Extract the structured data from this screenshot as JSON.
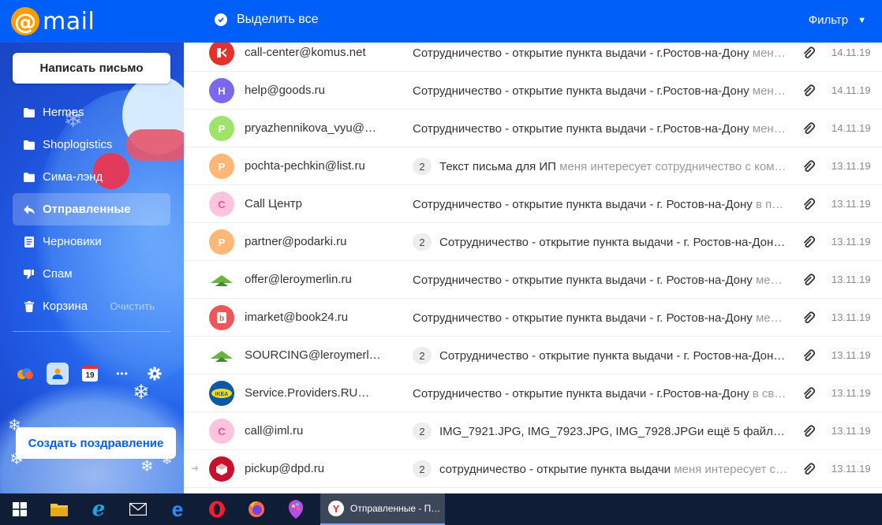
{
  "header": {
    "logo_symbol": "@",
    "logo_text": "mail",
    "select_all_label": "Выделить все",
    "filter_label": "Фильтр",
    "filter_caret": "▼",
    "accent_color": "#005ff9"
  },
  "sidebar": {
    "compose_label": "Написать письмо",
    "folders": [
      {
        "label": "Hermes",
        "icon": "folder-icon"
      },
      {
        "label": "Shoplogistics",
        "icon": "folder-icon"
      },
      {
        "label": "Сима-лэнд",
        "icon": "folder-icon"
      },
      {
        "label": "Отправленные",
        "icon": "sent-icon",
        "active": true
      },
      {
        "label": "Черновики",
        "icon": "drafts-icon"
      },
      {
        "label": "Спам",
        "icon": "spam-icon"
      },
      {
        "label": "Корзина",
        "icon": "trash-icon",
        "action": "Очистить"
      }
    ],
    "apps": [
      {
        "name": "cloud-icon"
      },
      {
        "name": "contacts-icon"
      },
      {
        "name": "calendar-icon",
        "text": "19"
      },
      {
        "name": "more-icon",
        "text": "•••"
      },
      {
        "name": "settings-icon"
      }
    ],
    "greeting_label": "Создать поздравление"
  },
  "messages": [
    {
      "sender": "call-center@komus.net",
      "count": "",
      "subject": "Сотрудничество - открытие пункта выдачи - г.Ростов-на-Дону",
      "snippet": " мен…",
      "date": "14.11.19",
      "avatar": {
        "type": "logo",
        "name": "komus-logo",
        "bg": "#e5312b"
      }
    },
    {
      "sender": "help@goods.ru",
      "count": "",
      "subject": "Сотрудничество - открытие пункта выдачи - г.Ростов-на-Дону",
      "snippet": " мен…",
      "date": "14.11.19",
      "avatar": {
        "type": "letter",
        "letter": "H",
        "bg": "#7b68ee",
        "fg": "#ffffff"
      }
    },
    {
      "sender": "pryazhennikova_vyu@…",
      "count": "",
      "subject": "Сотрудничество - открытие пункта выдачи - г.Ростов-на-Дону",
      "snippet": " мен…",
      "date": "14.11.19",
      "avatar": {
        "type": "letter",
        "letter": "P",
        "bg": "#9ee46a",
        "fg": "#ffffff"
      }
    },
    {
      "sender": "pochta-pechkin@list.ru",
      "count": "2",
      "subject": "Текст письма для ИП",
      "snippet": " меня интересует сотрудничество с ком…",
      "date": "13.11.19",
      "avatar": {
        "type": "letter",
        "letter": "P",
        "bg": "#ffb775",
        "fg": "#ffffff"
      }
    },
    {
      "sender": "Call Центр",
      "count": "",
      "subject": "Сотрудничество - открытие пункта выдачи - г. Ростов-на-Дону",
      "snippet": " в п…",
      "date": "13.11.19",
      "avatar": {
        "type": "letter",
        "letter": "C",
        "bg": "#ffc4dd",
        "fg": "#f0509a"
      }
    },
    {
      "sender": "partner@podarki.ru",
      "count": "2",
      "subject": "Сотрудничество - открытие пункта выдачи - г. Ростов-на-Дон…",
      "snippet": "",
      "date": "13.11.19",
      "avatar": {
        "type": "letter",
        "letter": "P",
        "bg": "#ffb775",
        "fg": "#ffffff"
      }
    },
    {
      "sender": "offer@leroymerlin.ru",
      "count": "",
      "subject": "Сотрудничество - открытие пункта выдачи - г. Ростов-на-Дону",
      "snippet": " ме…",
      "date": "13.11.19",
      "avatar": {
        "type": "logo",
        "name": "leroymerlin-logo",
        "bg": "#ffffff"
      }
    },
    {
      "sender": "imarket@book24.ru",
      "count": "",
      "subject": "Сотрудничество - открытие пункта выдачи - г. Ростов-на-Дону",
      "snippet": " ме…",
      "date": "13.11.19",
      "avatar": {
        "type": "logo",
        "name": "book24-logo",
        "bg": "#f0555a"
      }
    },
    {
      "sender": "SOURCING@leroymerl…",
      "count": "2",
      "subject": "Сотрудничество - открытие пункта выдачи - г. Ростов-на-Дон…",
      "snippet": "",
      "date": "13.11.19",
      "avatar": {
        "type": "logo",
        "name": "leroymerlin-logo",
        "bg": "#ffffff"
      }
    },
    {
      "sender": "Service.Providers.RU…",
      "count": "",
      "subject": "Сотрудничество - открытие пункта выдачи - г.Ростов-на-Дону",
      "snippet": " в св…",
      "date": "13.11.19",
      "avatar": {
        "type": "logo",
        "name": "ikea-logo",
        "bg": "#0a58a8"
      }
    },
    {
      "sender": "call@iml.ru",
      "count": "2",
      "subject": "IMG_7921.JPG, IMG_7923.JPG, IMG_7928.JPGи ещё 5 файл…",
      "snippet": "",
      "date": "13.11.19",
      "avatar": {
        "type": "letter",
        "letter": "C",
        "bg": "#ffc4dd",
        "fg": "#f0509a"
      }
    },
    {
      "sender": "pickup@dpd.ru",
      "count": "2",
      "subject": "сотрудничество - открытие пункта выдачи",
      "snippet": " меня интересует с…",
      "date": "13.11.19",
      "avatar": {
        "type": "logo",
        "name": "dpd-logo",
        "bg": "#c8102e"
      },
      "forwarded": true
    }
  ],
  "taskbar": {
    "items": [
      "windows-start-icon",
      "file-explorer-icon",
      "internet-explorer-icon",
      "mail-app-icon",
      "edge-icon",
      "opera-icon",
      "firefox-icon",
      "paint-app-icon"
    ],
    "active_window_label": "Отправленные - П…"
  }
}
